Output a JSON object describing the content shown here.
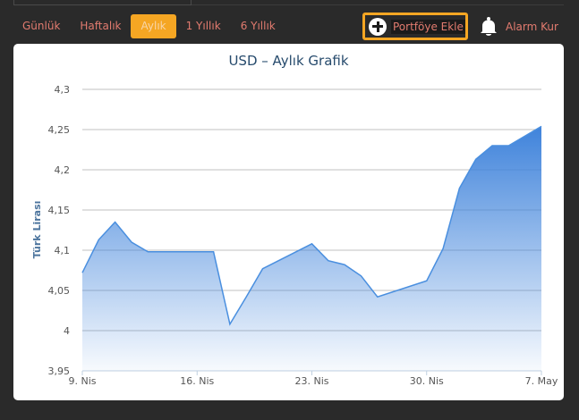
{
  "tabs": [
    {
      "label": "Günlük",
      "active": false
    },
    {
      "label": "Haftalık",
      "active": false
    },
    {
      "label": "Aylık",
      "active": true
    },
    {
      "label": "1 Yıllık",
      "active": false
    },
    {
      "label": "6 Yıllık",
      "active": false
    }
  ],
  "actions": {
    "portfolio_label": "Portföye Ekle",
    "alarm_label": "Alarm Kur"
  },
  "colors": {
    "accent": "#f5a623",
    "tab_text": "#e27b6f",
    "line": "#4a8fdf"
  },
  "chart_data": {
    "type": "area",
    "title": "USD – Aylık Grafik",
    "xlabel": "",
    "ylabel": "Türk Lirası",
    "ylim": [
      3.95,
      4.3
    ],
    "y_ticks": [
      3.95,
      4,
      4.05,
      4.1,
      4.15,
      4.2,
      4.25,
      4.3
    ],
    "y_tick_labels": [
      "3,95",
      "4",
      "4,05",
      "4,1",
      "4,15",
      "4,2",
      "4,25",
      "4,3"
    ],
    "x_ticks": [
      "9. Nis",
      "16. Nis",
      "23. Nis",
      "30. Nis",
      "7. May"
    ],
    "grid": true,
    "legend": "none",
    "series": [
      {
        "points": [
          [
            "09.04",
            4.072
          ],
          [
            "10.04",
            4.113
          ],
          [
            "11.04",
            4.135
          ],
          [
            "12.04",
            4.11
          ],
          [
            "13.04",
            4.098
          ],
          [
            "16.04",
            4.098
          ],
          [
            "17.04",
            4.098
          ],
          [
            "18.04",
            4.008
          ],
          [
            "19.04",
            4.042
          ],
          [
            "20.04",
            4.077
          ],
          [
            "23.04",
            4.108
          ],
          [
            "24.04",
            4.087
          ],
          [
            "25.04",
            4.082
          ],
          [
            "26.04",
            4.068
          ],
          [
            "27.04",
            4.042
          ],
          [
            "30.04",
            4.062
          ],
          [
            "01.05",
            4.102
          ],
          [
            "02.05",
            4.177
          ],
          [
            "03.05",
            4.213
          ],
          [
            "04.05",
            4.23
          ],
          [
            "05.05",
            4.23
          ],
          [
            "07.05",
            4.254
          ]
        ]
      }
    ]
  }
}
